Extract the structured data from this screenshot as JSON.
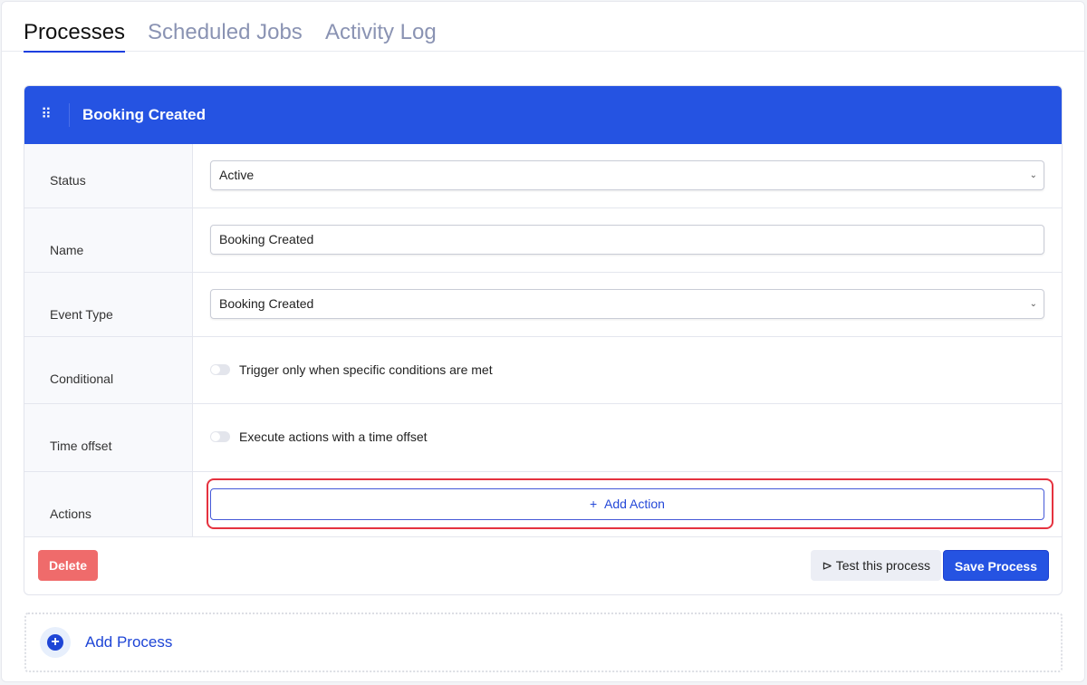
{
  "tabs": [
    {
      "label": "Processes",
      "active": true
    },
    {
      "label": "Scheduled Jobs"
    },
    {
      "label": "Activity Log"
    }
  ],
  "process": {
    "title": "Booking Created",
    "fields": {
      "status": {
        "label": "Status",
        "value": "Active"
      },
      "name": {
        "label": "Name",
        "value": "Booking Created"
      },
      "event_type": {
        "label": "Event Type",
        "value": "Booking Created"
      },
      "conditional": {
        "label": "Conditional",
        "toggle_text": "Trigger only when specific conditions are met",
        "enabled": false
      },
      "time_offset": {
        "label": "Time offset",
        "toggle_text": "Execute actions with a time offset",
        "enabled": false
      },
      "actions": {
        "label": "Actions",
        "add_label": "Add Action"
      }
    },
    "footer": {
      "delete": "Delete",
      "test": "Test this process",
      "save": "Save Process"
    }
  },
  "add_process": "Add Process",
  "colors": {
    "primary": "#2553e2",
    "danger": "#ef6b6b",
    "highlight": "#e5323f"
  }
}
